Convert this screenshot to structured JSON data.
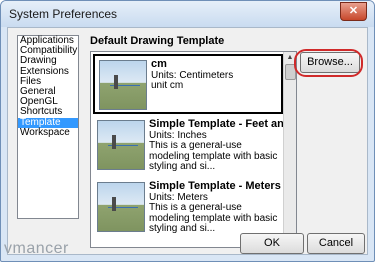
{
  "window": {
    "title": "System Preferences",
    "close_label": "✕"
  },
  "nav": {
    "items": [
      "Applications",
      "Compatibility",
      "Drawing",
      "Extensions",
      "Files",
      "General",
      "OpenGL",
      "Shortcuts",
      "Template",
      "Workspace"
    ],
    "selected_index": 8
  },
  "section": {
    "title": "Default Drawing Template"
  },
  "templates": [
    {
      "name": "cm",
      "units": "Units: Centimeters",
      "desc": "unit cm",
      "selected": true
    },
    {
      "name": "Simple Template - Feet an...",
      "units": "Units: Inches",
      "desc": "This is a general-use modeling template with basic styling and si...",
      "selected": false
    },
    {
      "name": "Simple Template - Meters",
      "units": "Units: Meters",
      "desc": "This is a general-use modeling template with basic styling and si...",
      "selected": false
    }
  ],
  "buttons": {
    "browse": "Browse...",
    "ok": "OK",
    "cancel": "Cancel"
  },
  "watermark": "vmancer",
  "colors": {
    "highlight": "#d02a2a",
    "selection": "#3399ff"
  }
}
